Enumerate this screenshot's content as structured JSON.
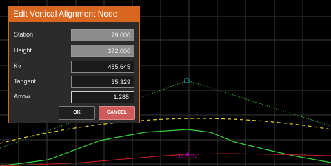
{
  "dialog": {
    "title": "Edit Vertical Alignment Node",
    "fields": [
      {
        "label": "Station",
        "value": "79.000",
        "readonly": true
      },
      {
        "label": "Height",
        "value": "372.000",
        "readonly": true
      },
      {
        "label": "Kv",
        "value": "485.645",
        "readonly": false
      },
      {
        "label": "Tangent",
        "value": "35.329",
        "readonly": false
      },
      {
        "label": "Arrow",
        "value": "1.285",
        "readonly": false
      }
    ],
    "ok_label": "OK",
    "cancel_label": "CANCEL"
  },
  "canvas": {
    "annotation": "D=2.356",
    "colors": {
      "background": "#000000",
      "grid": "#3a3a3a",
      "tangent_line": "#3fae3f",
      "profile_line": "#39d33c",
      "design_curve": "#e5d22a",
      "ground_line": "#cc2020",
      "annotation": "#b000b0",
      "node_marker": "#24b3b3"
    }
  }
}
